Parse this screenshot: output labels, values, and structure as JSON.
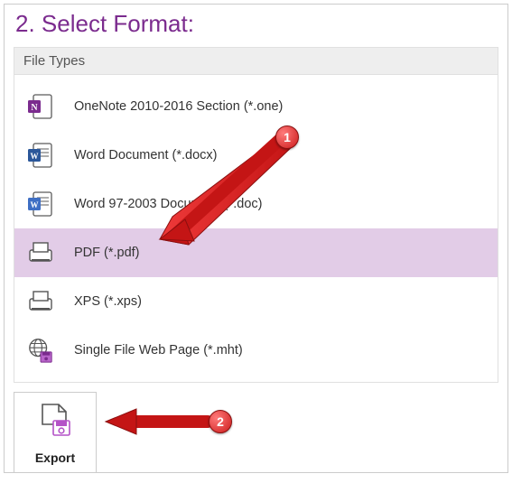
{
  "heading": "2. Select Format:",
  "file_types_header": "File Types",
  "items": [
    {
      "icon": "onenote-icon",
      "label": "OneNote 2010-2016 Section (*.one)",
      "selected": false
    },
    {
      "icon": "word-docx-icon",
      "label": "Word Document (*.docx)",
      "selected": false
    },
    {
      "icon": "word-doc-icon",
      "label": "Word 97-2003 Document (*.doc)",
      "selected": false
    },
    {
      "icon": "pdf-icon",
      "label": "PDF (*.pdf)",
      "selected": true
    },
    {
      "icon": "xps-icon",
      "label": "XPS (*.xps)",
      "selected": false
    },
    {
      "icon": "mht-icon",
      "label": "Single File Web Page (*.mht)",
      "selected": false
    }
  ],
  "export_button": "Export",
  "annotations": {
    "marker1": "1",
    "marker2": "2"
  }
}
